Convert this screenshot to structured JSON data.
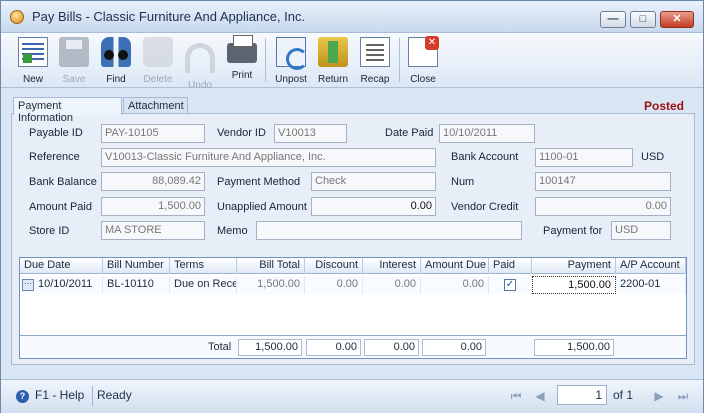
{
  "window": {
    "title": "Pay Bills - Classic Furniture And Appliance, Inc.",
    "minimize": "—",
    "maximize": "□",
    "close": "✕"
  },
  "toolbar": {
    "new": "New",
    "save": "Save",
    "find": "Find",
    "delete": "Delete",
    "undo": "Undo",
    "print": "Print",
    "unpost": "Unpost",
    "return": "Return",
    "recap": "Recap",
    "close": "Close"
  },
  "tabs": [
    "Payment Information",
    "Attachment"
  ],
  "status_badge": "Posted",
  "fields": {
    "payable_id": {
      "label": "Payable ID",
      "value": "PAY-10105"
    },
    "vendor_id": {
      "label": "Vendor ID",
      "value": "V10013"
    },
    "date_paid": {
      "label": "Date Paid",
      "value": "10/10/2011"
    },
    "reference": {
      "label": "Reference",
      "value": "V10013-Classic Furniture And Appliance, Inc."
    },
    "bank_account": {
      "label": "Bank Account",
      "value": "1100-01",
      "currency": "USD"
    },
    "bank_balance": {
      "label": "Bank Balance",
      "value": "88,089.42"
    },
    "payment_method": {
      "label": "Payment Method",
      "value": "Check"
    },
    "num": {
      "label": "Num",
      "value": "100147"
    },
    "amount_paid": {
      "label": "Amount Paid",
      "value": "1,500.00"
    },
    "unapplied_amount": {
      "label": "Unapplied Amount",
      "value": "0.00"
    },
    "vendor_credit": {
      "label": "Vendor Credit",
      "value": "0.00"
    },
    "store_id": {
      "label": "Store ID",
      "value": "MA STORE"
    },
    "memo": {
      "label": "Memo",
      "value": ""
    },
    "payment_for": {
      "label": "Payment for",
      "value": "USD"
    }
  },
  "grid": {
    "columns": [
      "Due Date",
      "Bill Number",
      "Terms",
      "Bill Total",
      "Discount",
      "Interest",
      "Amount Due",
      "Paid",
      "Payment",
      "A/P Account"
    ],
    "rows": [
      {
        "row_button": "···",
        "due_date": "10/10/2011",
        "bill_number": "BL-10110",
        "terms": "Due on Rece",
        "bill_total": "1,500.00",
        "discount": "0.00",
        "interest": "0.00",
        "amount_due": "0.00",
        "paid": "✓",
        "payment": "1,500.00",
        "ap_account": "2200-01"
      }
    ],
    "totals": {
      "label": "Total",
      "bill_total": "1,500.00",
      "discount": "0.00",
      "interest": "0.00",
      "amount_due": "0.00",
      "payment": "1,500.00"
    }
  },
  "statusbar": {
    "help": "F1 - Help",
    "help_icon": "?",
    "state": "Ready",
    "page": "1",
    "of_label": "of 1",
    "first": "⏮",
    "prev": "◀",
    "next": "▶",
    "last": "⏭"
  }
}
